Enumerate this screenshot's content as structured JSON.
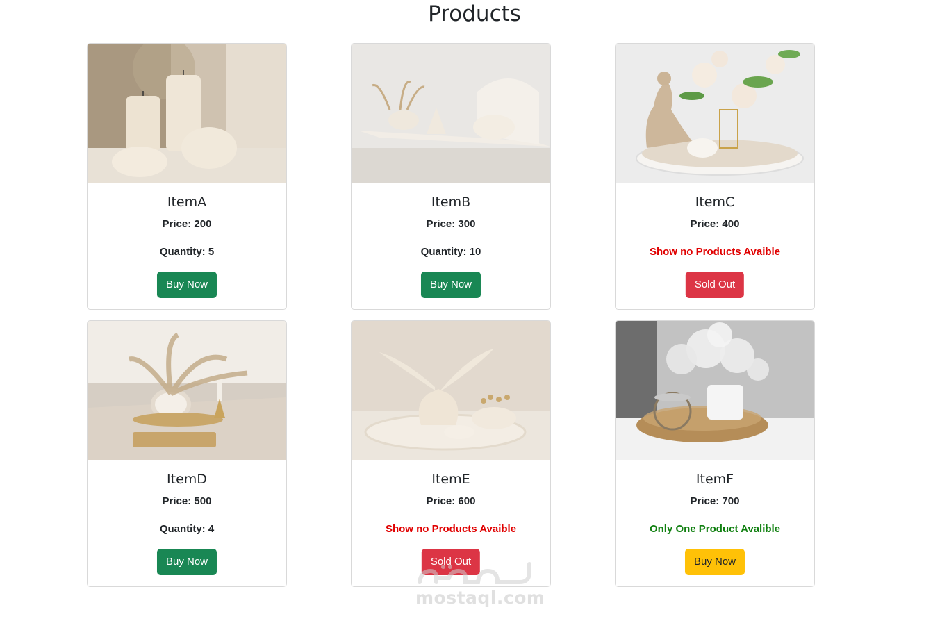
{
  "page": {
    "title": "Products"
  },
  "products": [
    {
      "name": "ItemA",
      "price": "Price: 200",
      "stock": "Quantity: 5",
      "button": "Buy Now",
      "image": "candles-image"
    },
    {
      "name": "ItemB",
      "price": "Price: 300",
      "stock": "Quantity: 10",
      "button": "Buy Now",
      "image": "tray-decor-image"
    },
    {
      "name": "ItemC",
      "price": "Price: 400",
      "stock": "Show no Products Avaible",
      "button": "Sold Out",
      "image": "roses-figurine-image"
    },
    {
      "name": "ItemD",
      "price": "Price: 500",
      "stock": "Quantity: 4",
      "button": "Buy Now",
      "image": "pampas-vase-image"
    },
    {
      "name": "ItemE",
      "price": "Price: 600",
      "stock": "Show no Products Avaible",
      "button": "Sold Out",
      "image": "ceramic-vases-image"
    },
    {
      "name": "ItemF",
      "price": "Price: 700",
      "stock": "Only One Product Avalible",
      "button": "Buy Now",
      "image": "babys-breath-tray-image"
    }
  ],
  "colors": {
    "buy_button": "#198754",
    "sold_out_button": "#dc3545",
    "last_item_button": "#ffc107",
    "out_of_stock_text": "#e00000",
    "one_left_text": "#118011"
  },
  "watermark": {
    "text": "mostaql.com",
    "logo": "mostaql-logo"
  }
}
